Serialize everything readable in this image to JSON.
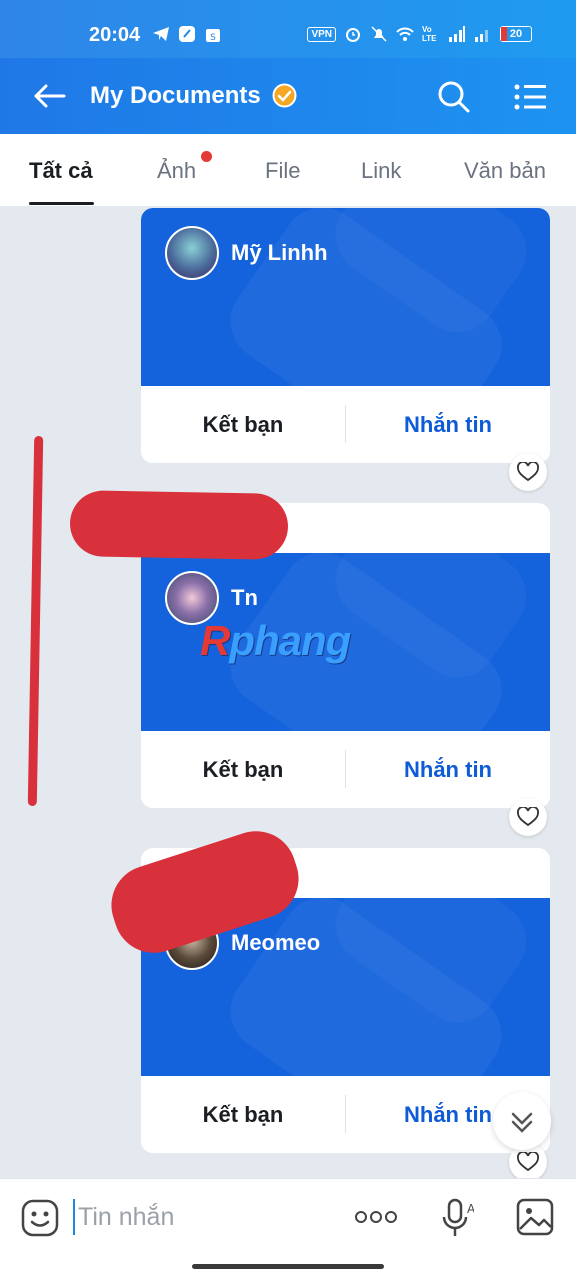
{
  "status_bar": {
    "time": "20:04",
    "vpn": "VPN",
    "volte": "Vo LTE",
    "battery": "20"
  },
  "header": {
    "title": "My Documents",
    "back_icon": "arrow-left-icon",
    "verified_icon": "verified-badge-icon",
    "search_icon": "search-icon",
    "menu_icon": "list-menu-icon"
  },
  "tabs": [
    {
      "label": "Tất cả",
      "active": true
    },
    {
      "label": "Ảnh",
      "active": false,
      "badge": true
    },
    {
      "label": "File",
      "active": false
    },
    {
      "label": "Link",
      "active": false
    },
    {
      "label": "Văn bản",
      "active": false
    }
  ],
  "cards": [
    {
      "name": "Mỹ Linhh",
      "friend_label": "Kết bạn",
      "message_label": "Nhắn tin"
    },
    {
      "name": "Tn",
      "friend_label": "Kết bạn",
      "message_label": "Nhắn tin"
    },
    {
      "name": "Meomeo",
      "friend_label": "Kết bạn",
      "message_label": "Nhắn tin"
    }
  ],
  "watermark": {
    "first": "R",
    "rest": "phang"
  },
  "input_bar": {
    "placeholder": "Tin nhắn"
  },
  "colors": {
    "header": "#1f78e6",
    "card_blue": "#1462dc",
    "message_text": "#0d5bd6",
    "badge_red": "#e53935"
  }
}
